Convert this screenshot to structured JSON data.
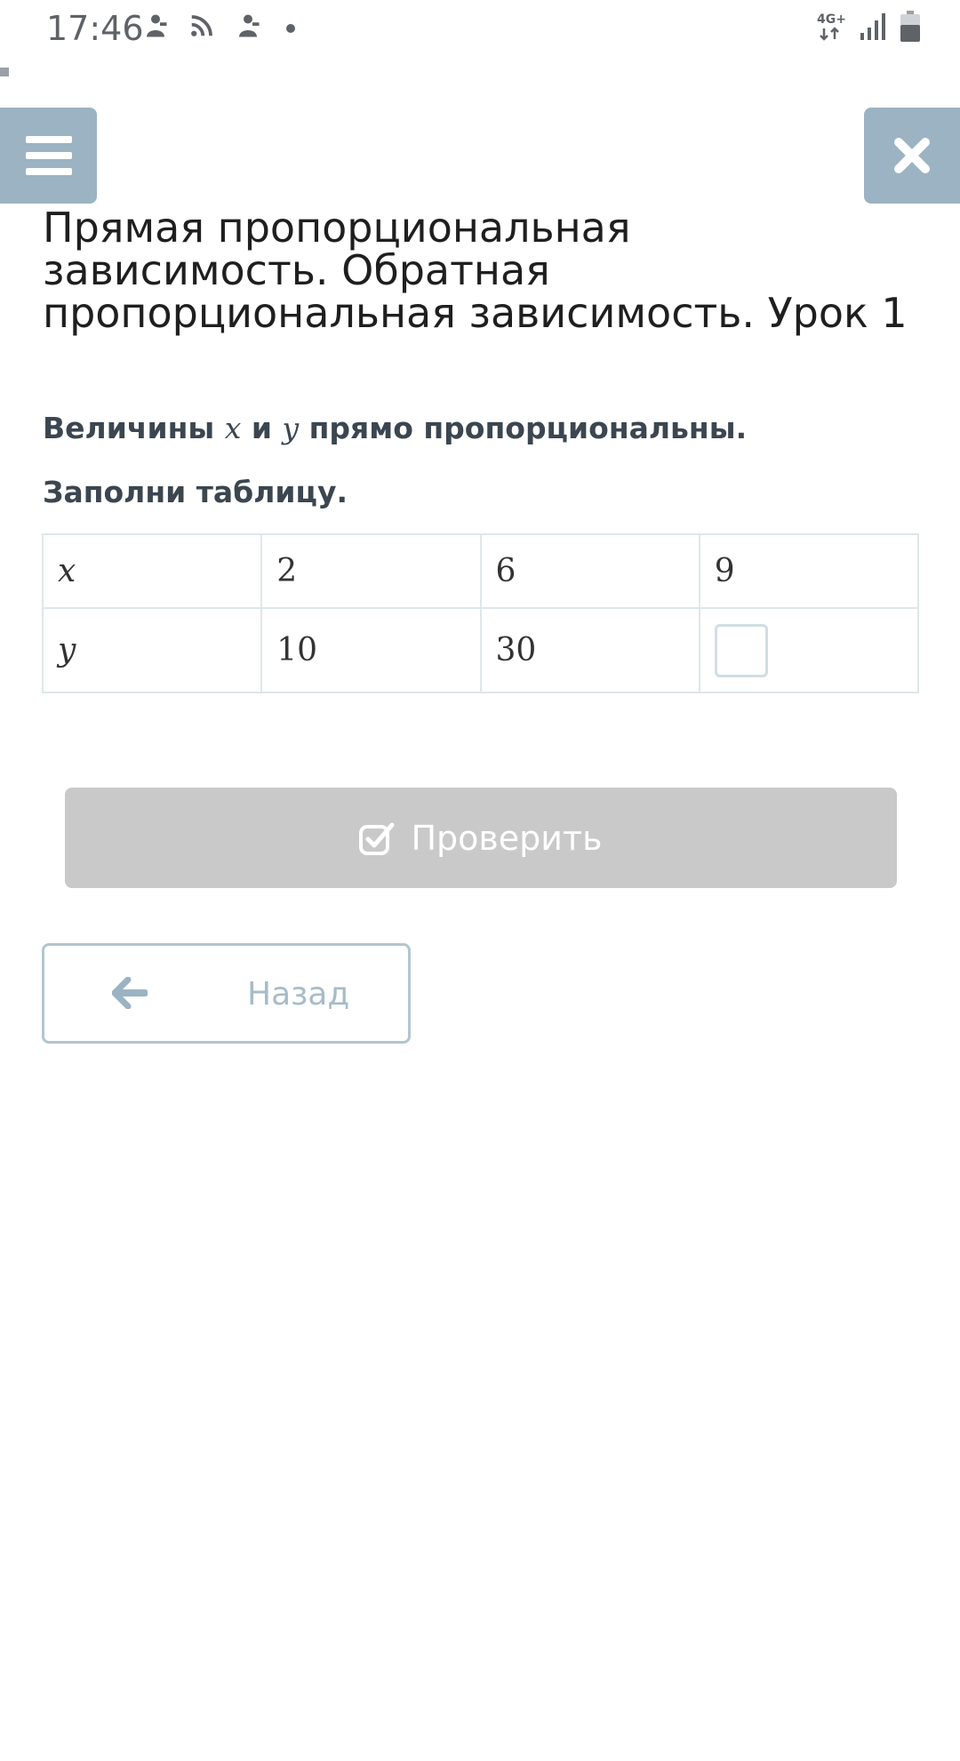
{
  "status_bar": {
    "time": "17:46",
    "network_label": "4G+",
    "icons": [
      "notification-icon",
      "cast-icon",
      "notification-icon",
      "dot-icon",
      "network-arrows-icon",
      "signal-icon",
      "battery-icon"
    ]
  },
  "header": {
    "menu_icon": "hamburger-icon",
    "close_icon": "close-icon",
    "accent_color": "#9bb3c2"
  },
  "lesson": {
    "title": "Прямая пропорциональная зависимость. Обратная пропорциональная зависимость. Урок 1"
  },
  "task": {
    "line1_prefix": "Величины ",
    "var_x": "x",
    "and_word": " и ",
    "var_y": "y",
    "line1_suffix": " прямо пропорциональны.",
    "line2": "Заполни таблицу."
  },
  "table": {
    "rows": [
      {
        "label": "x",
        "cells": [
          "2",
          "6",
          "9"
        ]
      },
      {
        "label": "y",
        "cells": [
          "10",
          "30",
          ""
        ]
      }
    ]
  },
  "buttons": {
    "check_label": "Проверить",
    "check_icon": "checkbox-check-icon",
    "back_label": "Назад",
    "back_icon": "arrow-left-icon"
  }
}
